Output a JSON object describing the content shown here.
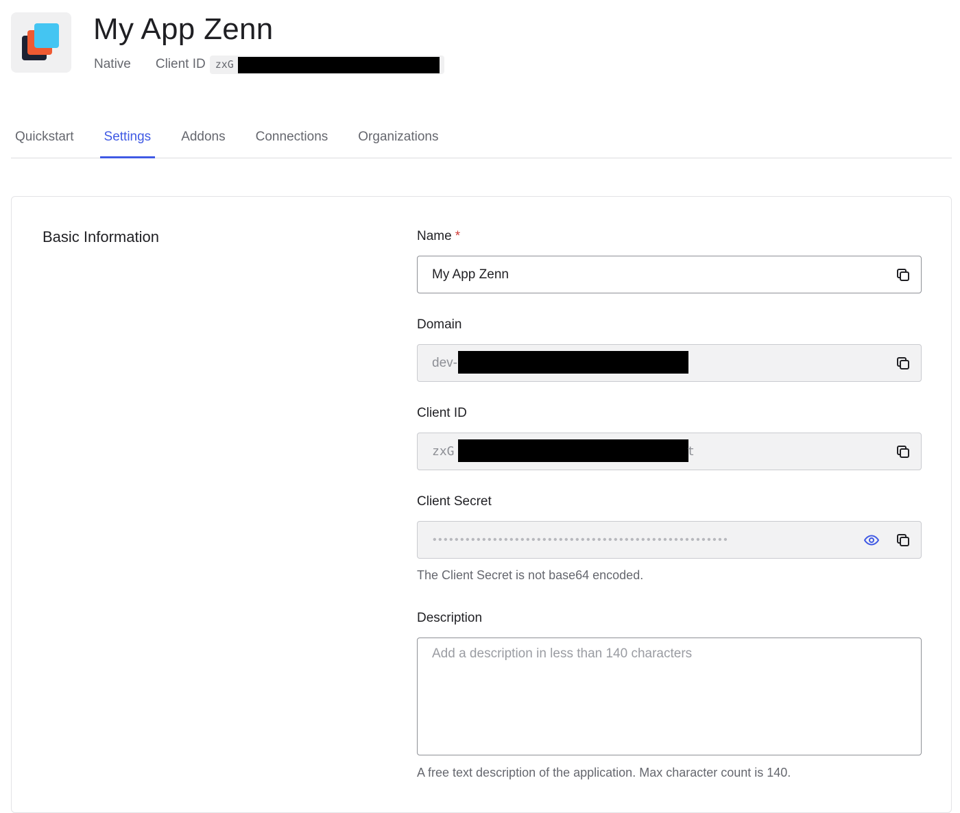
{
  "header": {
    "app_name": "My App Zenn",
    "app_type": "Native",
    "client_id_label": "Client ID",
    "client_id_visible": "zxG"
  },
  "tabs": [
    {
      "label": "Quickstart",
      "active": false
    },
    {
      "label": "Settings",
      "active": true
    },
    {
      "label": "Addons",
      "active": false
    },
    {
      "label": "Connections",
      "active": false
    },
    {
      "label": "Organizations",
      "active": false
    }
  ],
  "basic_info": {
    "section_title": "Basic Information",
    "name": {
      "label": "Name",
      "required_mark": "*",
      "value": "My App Zenn"
    },
    "domain": {
      "label": "Domain",
      "value_visible": "dev-"
    },
    "client_id": {
      "label": "Client ID",
      "value_visible": "zxG",
      "value_tail": "t"
    },
    "client_secret": {
      "label": "Client Secret",
      "masked_value": "••••••••••••••••••••••••••••••••••••••••••••••••••••••",
      "helper": "The Client Secret is not base64 encoded."
    },
    "description": {
      "label": "Description",
      "placeholder": "Add a description in less than 140 characters",
      "helper": "A free text description of the application. Max character count is 140."
    }
  },
  "colors": {
    "accent": "#3f59e4",
    "required": "#d03c38",
    "logo_dark": "#1d2233",
    "logo_orange": "#ef5a32",
    "logo_blue": "#44c5f2"
  },
  "icons": {
    "copy": "copy-icon",
    "reveal": "eye-icon"
  }
}
